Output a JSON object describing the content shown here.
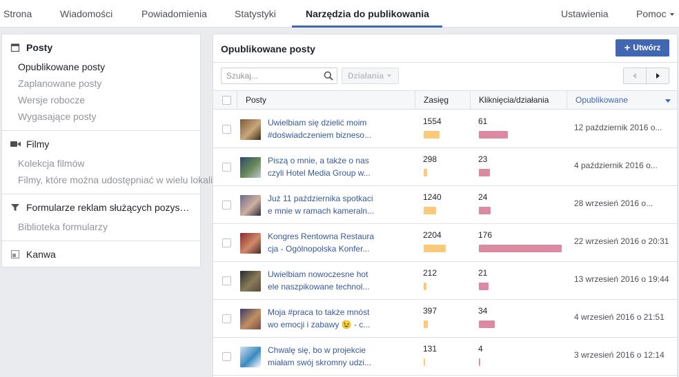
{
  "nav": {
    "tabs": [
      {
        "label": "Strona"
      },
      {
        "label": "Wiadomości"
      },
      {
        "label": "Powiadomienia"
      },
      {
        "label": "Statystyki"
      },
      {
        "label": "Narzędzia do publikowania",
        "active": true
      }
    ],
    "settings": "Ustawienia",
    "help": "Pomoc"
  },
  "sidebar": {
    "posts": {
      "title": "Posty",
      "icon": "calendar-icon",
      "items": [
        "Opublikowane posty",
        "Zaplanowane posty",
        "Wersje robocze",
        "Wygasające posty"
      ]
    },
    "videos": {
      "title": "Filmy",
      "icon": "video-camera-icon",
      "items": [
        "Kolekcja filmów",
        "Filmy, które można udostępniać w wielu lokalizacjach"
      ]
    },
    "forms": {
      "title": "Formularze reklam służących pozys…",
      "icon": "filter-icon",
      "items": [
        "Biblioteka formularzy"
      ]
    },
    "canvas": {
      "title": "Kanwa",
      "icon": "canvas-icon"
    }
  },
  "main": {
    "title": "Opublikowane posty",
    "create_label": "Utwórz",
    "search_placeholder": "Szukaj...",
    "actions_label": "Działania",
    "columns": {
      "posts": "Posty",
      "reach": "Zasięg",
      "clicks": "Kliknięcia/działania",
      "published": "Opublikowane"
    },
    "rows": [
      {
        "line1": "Uwielbiam się dzielić moim",
        "line2": "#doświadczeniem bizneso...",
        "reach": "1554",
        "reach_fraction": 0.19,
        "clicks": "61",
        "clicks_fraction": 0.35,
        "date": "12 październik 2016 o..."
      },
      {
        "line1": "Piszą o mnie, a także o nas",
        "line2": "czyli Hotel Media Group w...",
        "reach": "298",
        "reach_fraction": 0.04,
        "clicks": "23",
        "clicks_fraction": 0.13,
        "date": "4 październik 2016 o..."
      },
      {
        "line1": "Już 11 października spotkaci",
        "line2": "e mnie w ramach kameraln...",
        "reach": "1240",
        "reach_fraction": 0.15,
        "clicks": "24",
        "clicks_fraction": 0.14,
        "date": "28 wrzesień 2016 o..."
      },
      {
        "line1": "Kongres Rentowna Restaura",
        "line2": "cja - Ogólnopolska Konfer...",
        "reach": "2204",
        "reach_fraction": 0.27,
        "clicks": "176",
        "clicks_fraction": 1.0,
        "date": "22 wrzesień 2016 o 20:31"
      },
      {
        "line1": "Uwielbiam nowoczesne hot",
        "line2": "ele naszpikowane technol...",
        "reach": "212",
        "reach_fraction": 0.03,
        "clicks": "21",
        "clicks_fraction": 0.12,
        "date": "13 wrzesień 2016 o 19:44"
      },
      {
        "line1": "Moja #praca to także mnóst",
        "line2": "wo emocji i zabawy 😉 - c...",
        "reach": "397",
        "reach_fraction": 0.05,
        "clicks": "34",
        "clicks_fraction": 0.19,
        "date": "4 wrzesień 2016 o 21:51"
      },
      {
        "line1": "Chwalę się, bo w projekcie",
        "line2": "miałam swój skromny udzi...",
        "reach": "131",
        "reach_fraction": 0.02,
        "clicks": "4",
        "clicks_fraction": 0.02,
        "date": "3 wrzesień 2016 o 12:14"
      }
    ]
  },
  "colors": {
    "accent": "#4267b2",
    "link": "#365899",
    "reach_bar": "#fbc97a",
    "clicks_bar": "#dc8aa2"
  }
}
